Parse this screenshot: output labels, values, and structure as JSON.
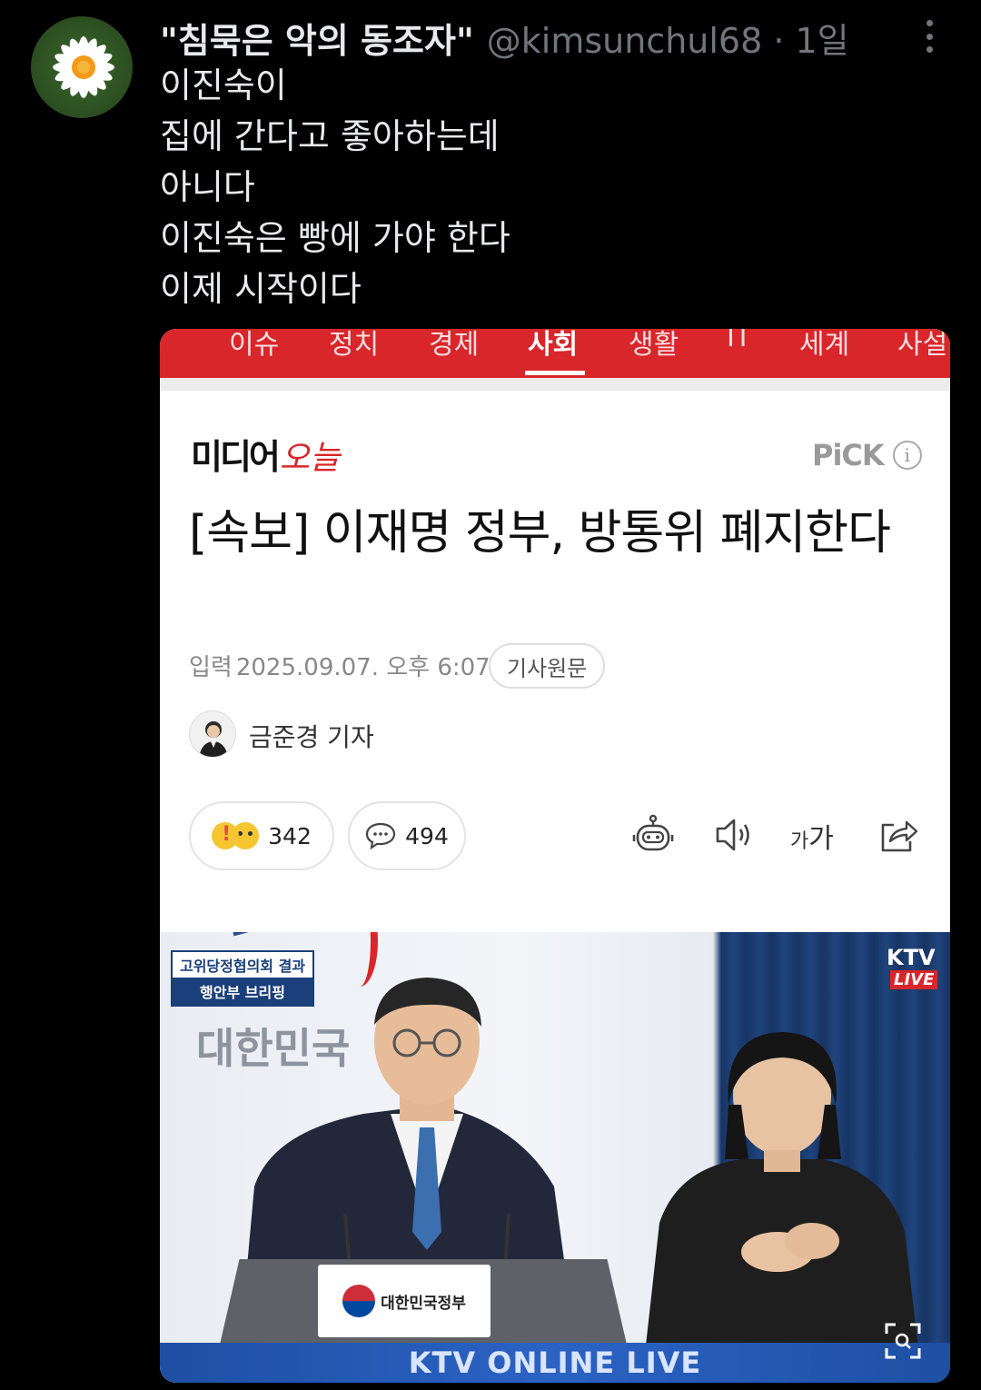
{
  "tweet": {
    "display_name": "\"침묵은 악의 동조자\"",
    "handle": "@kimsunchul68 · 1일",
    "lines": [
      "이진숙이",
      "집에 간다고 좋아하는데",
      "아니다",
      "이진숙은 빵에 가야 한다",
      "이제 시작이다"
    ]
  },
  "news_nav": {
    "items": [
      "",
      "이슈",
      "정치",
      "경제",
      "사회",
      "생활",
      "IT",
      "세계",
      "사설"
    ],
    "active": "사회",
    "color": "#d8262b"
  },
  "article": {
    "press_logo_a": "미디어",
    "press_logo_b": "오늘",
    "pick_label": "PiCK",
    "headline": "[속보] 이재명 정부, 방통위 폐지한다",
    "date_label": "입력",
    "date": "2025.09.07. 오후 6:07",
    "original_link": "기사원문",
    "reporter": "금준경 기자",
    "reaction_count": "342",
    "comment_count": "494",
    "font_size_label_small": "가",
    "font_size_label_large": "가"
  },
  "video": {
    "caption_top": "고위당정협의회 결과",
    "caption_bottom": "행안부 브리핑",
    "wall_text": "대한민국",
    "channel": "KTV",
    "live_badge": "LIVE",
    "podium_label": "대한민국정부",
    "bottom_banner": "KTV ONLINE LIVE"
  }
}
